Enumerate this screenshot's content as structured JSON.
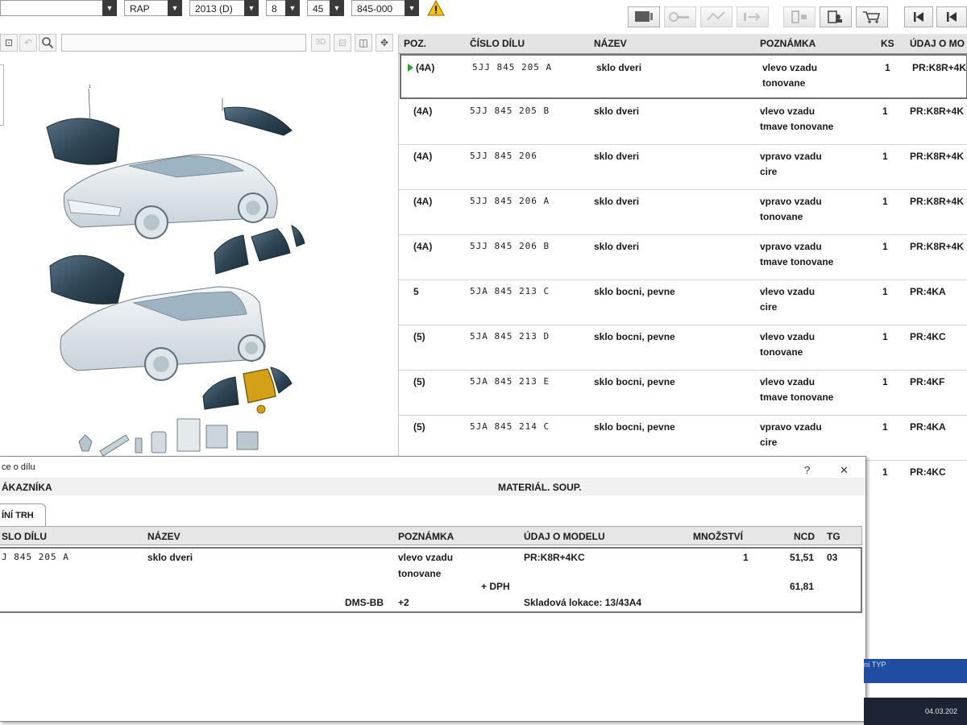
{
  "toolbar": {
    "combos": [
      {
        "value": ""
      },
      {
        "value": "RAP"
      },
      {
        "value": "2013 (D)"
      },
      {
        "value": "8"
      },
      {
        "value": "45"
      },
      {
        "value": "845-000"
      }
    ]
  },
  "parts_table": {
    "headers": {
      "pos": "POZ.",
      "part_no": "ČÍSLO DÍLU",
      "name": "NÁZEV",
      "note": "POZNÁMKA",
      "qty": "KS",
      "model": "ÚDAJ O MO"
    },
    "rows": [
      {
        "pos": "(4A)",
        "part_no": "5JJ 845 205 A",
        "name": "sklo dveri",
        "note1": "vlevo vzadu",
        "note2": "tonovane",
        "qty": "1",
        "model": "PR:K8R+4K"
      },
      {
        "pos": "(4A)",
        "part_no": "5JJ 845 205 B",
        "name": "sklo dveri",
        "note1": "vlevo vzadu",
        "note2": "tmave tonovane",
        "qty": "1",
        "model": "PR:K8R+4K"
      },
      {
        "pos": "(4A)",
        "part_no": "5JJ 845 206",
        "name": "sklo dveri",
        "note1": "vpravo vzadu",
        "note2": "cire",
        "qty": "1",
        "model": "PR:K8R+4K"
      },
      {
        "pos": "(4A)",
        "part_no": "5JJ 845 206 A",
        "name": "sklo dveri",
        "note1": "vpravo vzadu",
        "note2": "tonovane",
        "qty": "1",
        "model": "PR:K8R+4K"
      },
      {
        "pos": "(4A)",
        "part_no": "5JJ 845 206 B",
        "name": "sklo dveri",
        "note1": "vpravo vzadu",
        "note2": "tmave tonovane",
        "qty": "1",
        "model": "PR:K8R+4K"
      },
      {
        "pos": "5",
        "part_no": "5JA 845 213 C",
        "name": "sklo bocni, pevne",
        "note1": "vlevo vzadu",
        "note2": "cire",
        "qty": "1",
        "model": "PR:4KA"
      },
      {
        "pos": "(5)",
        "part_no": "5JA 845 213 D",
        "name": "sklo bocni, pevne",
        "note1": "vlevo vzadu",
        "note2": "tonovane",
        "qty": "1",
        "model": "PR:4KC"
      },
      {
        "pos": "(5)",
        "part_no": "5JA 845 213 E",
        "name": "sklo bocni, pevne",
        "note1": "vlevo vzadu",
        "note2": "tmave tonovane",
        "qty": "1",
        "model": "PR:4KF"
      },
      {
        "pos": "(5)",
        "part_no": "5JA 845 214 C",
        "name": "sklo bocni, pevne",
        "note1": "vpravo vzadu",
        "note2": "cire",
        "qty": "1",
        "model": "PR:4KA"
      },
      {
        "pos": "",
        "part_no": "",
        "name": "",
        "note1": "",
        "note2": "",
        "qty": "1",
        "model": "PR:4KC"
      }
    ]
  },
  "dialog": {
    "title": "ce o dílu",
    "help": "?",
    "close": "✕",
    "customer_label": "ÁKAZNÍKA",
    "material_label": "MATERIÁL. SOUP.",
    "tab_label": "ÍNÍ TRH",
    "headers": {
      "part_no": "SLO DÍLU",
      "name": "NÁZEV",
      "note": "POZNÁMKA",
      "model": "ÚDAJ O MODELU",
      "qty": "MNOŽSTVÍ",
      "ncd": "NCD",
      "tg": "TG"
    },
    "row": {
      "part_no": "J 845 205 A",
      "name": "sklo dveri",
      "note1": "vlevo vzadu",
      "note2": "tonovane",
      "model": "PR:K8R+4KC",
      "qty": "1",
      "ncd": "51,51",
      "tg": "03",
      "vat_label": "+ DPH",
      "ncd_vat": "61,81",
      "dms_label": "DMS-BB",
      "dms_value": "+2",
      "location": "Skladová lokace: 13/43A4"
    }
  },
  "footer": {
    "band_text": "ní TYP",
    "date": "04.03.202"
  }
}
